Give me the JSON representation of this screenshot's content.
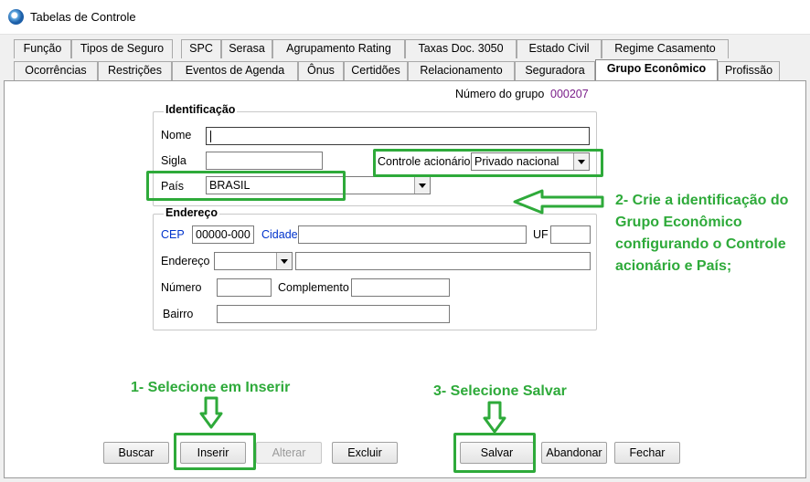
{
  "window": {
    "title": "Tabelas de Controle",
    "icon": "app-globe-icon"
  },
  "tabs_row1": [
    "Função",
    "Tipos de Seguro",
    "SPC",
    "Serasa",
    "Agrupamento Rating",
    "Taxas Doc. 3050",
    "Estado Civil",
    "Regime Casamento"
  ],
  "tabs_row2": [
    "Ocorrências",
    "Restrições",
    "Eventos de Agenda",
    "Ônus",
    "Certidões",
    "Relacionamento",
    "Seguradora",
    "Grupo Econômico",
    "Profissão"
  ],
  "active_tab": "Grupo Econômico",
  "group_number": {
    "label": "Número do grupo",
    "value": "000207"
  },
  "identificacao": {
    "legend": "Identificação",
    "nome_label": "Nome",
    "nome_value": "",
    "sigla_label": "Sigla",
    "sigla_value": "",
    "controle_label": "Controle acionário",
    "controle_value": "Privado nacional",
    "pais_label": "País",
    "pais_value": "BRASIL"
  },
  "endereco": {
    "legend": "Endereço",
    "cep_label": "CEP",
    "cep_value": "00000-000",
    "cidade_label": "Cidade",
    "cidade_value": "",
    "uf_label": "UF",
    "uf_value": "",
    "endereco_label": "Endereço",
    "endereco_type_value": "",
    "endereco_value": "",
    "numero_label": "Número",
    "numero_value": "",
    "complemento_label": "Complemento",
    "complemento_value": "",
    "bairro_label": "Bairro",
    "bairro_value": ""
  },
  "buttons": {
    "buscar": "Buscar",
    "inserir": "Inserir",
    "alterar": "Alterar",
    "excluir": "Excluir",
    "salvar": "Salvar",
    "abandonar": "Abandonar",
    "fechar": "Fechar"
  },
  "annotations": {
    "step1": "1- Selecione em Inserir",
    "step2": "2- Crie a identificação do Grupo Econômico configurando o Controle acionário e País;",
    "step3": "3- Selecione Salvar",
    "color": "#2eaa3a"
  }
}
